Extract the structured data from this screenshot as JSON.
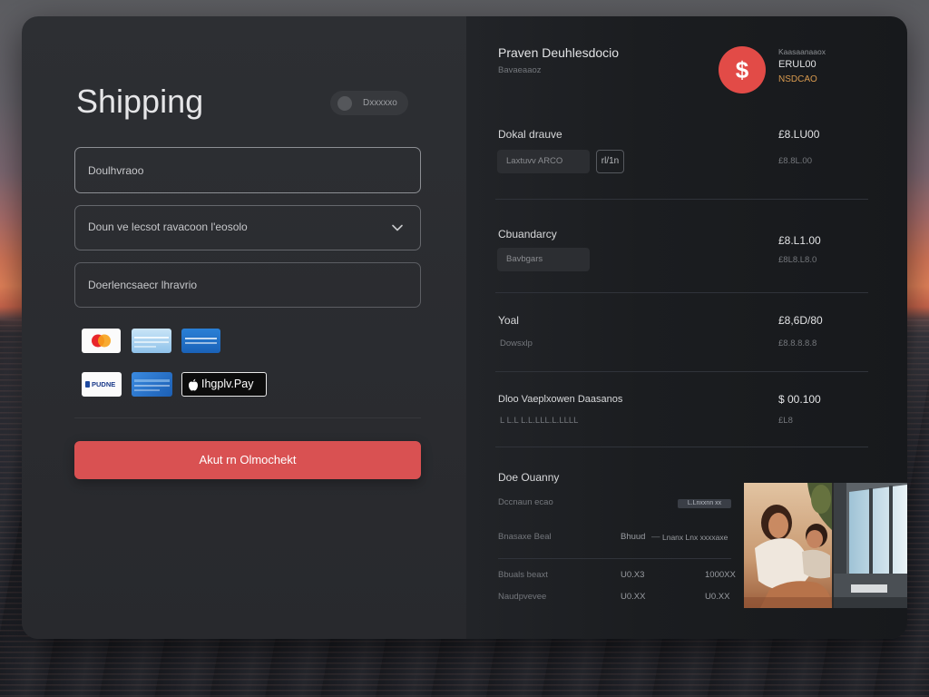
{
  "theme": {
    "accent": "#d95152",
    "badge_red": "#e24b47",
    "highlight_orange": "#d89a4f",
    "panel_left": "#2b2d31",
    "panel_right": "#1b1d20"
  },
  "shipping": {
    "title": "Shipping",
    "toggle": {
      "label": "Dxxxxxo"
    },
    "address_field": {
      "placeholder": "Doulhvraoo"
    },
    "region_select": {
      "value": "Doun ve lecsot ravacoon l'eosolo",
      "icon": "chevron-down-icon"
    },
    "notes_field": {
      "placeholder": "Doerlencsaecr lhravrio"
    },
    "payment_methods": [
      {
        "icon": "mastercard-icon"
      },
      {
        "icon": "light-blue-card-icon"
      },
      {
        "icon": "blue-card-icon"
      },
      {
        "icon": "paypal-icon",
        "label": "PUDNE"
      },
      {
        "icon": "blue-card-icon"
      },
      {
        "icon": "apple-pay-icon",
        "label": "Ihgplv.Pay"
      }
    ],
    "submit_label": "Akut rn Olmochekt"
  },
  "summary": {
    "title": "Praven Deuhlesdocio",
    "subtitle": "Bavaeaaoz",
    "badge_symbol": "$",
    "meta": {
      "label": "Kaasaanaaox",
      "amount": "ERUL00",
      "status": "NSDCAO"
    },
    "rows": [
      {
        "label": "Dokal drauve",
        "value": "£8.LU00",
        "sub_value": "£8.8L.00",
        "chip": "Laxtuvv ARCO",
        "chip_extra": "rl/1n"
      },
      {
        "label": "Cbuandarcy",
        "value": "£8.L1.00",
        "sub_value": "£8L8.L8.0",
        "chip": "Bavbgars"
      },
      {
        "label": "Yoal",
        "sub_label": "Dowsxlp",
        "value": "£8,6D/80",
        "sub_value": "£8.8.8.8.8"
      },
      {
        "label": "Dloo Vaeplxowen Daasanos",
        "sub_label": "L L.L L.L.LLL.L.LLLL",
        "value": "$ 00.100",
        "sub_value": "£L8"
      }
    ],
    "details": {
      "title": "Doe Ouanny",
      "subtitle": "Dccnaun ecao",
      "badge": "L.Lnxxnn xx",
      "header": {
        "label": "Bnasaxe Beal",
        "col1": "Bhuud",
        "sep": "—",
        "col2": "Lnanx Lnx xxxxaxe"
      },
      "lines": [
        {
          "label": "Bbuals beaxt",
          "col1": "U0.X3",
          "col2": "1000XX"
        },
        {
          "label": "Naudpvevee",
          "col1": "U0.XX",
          "col2": "U0.XX"
        }
      ]
    }
  }
}
